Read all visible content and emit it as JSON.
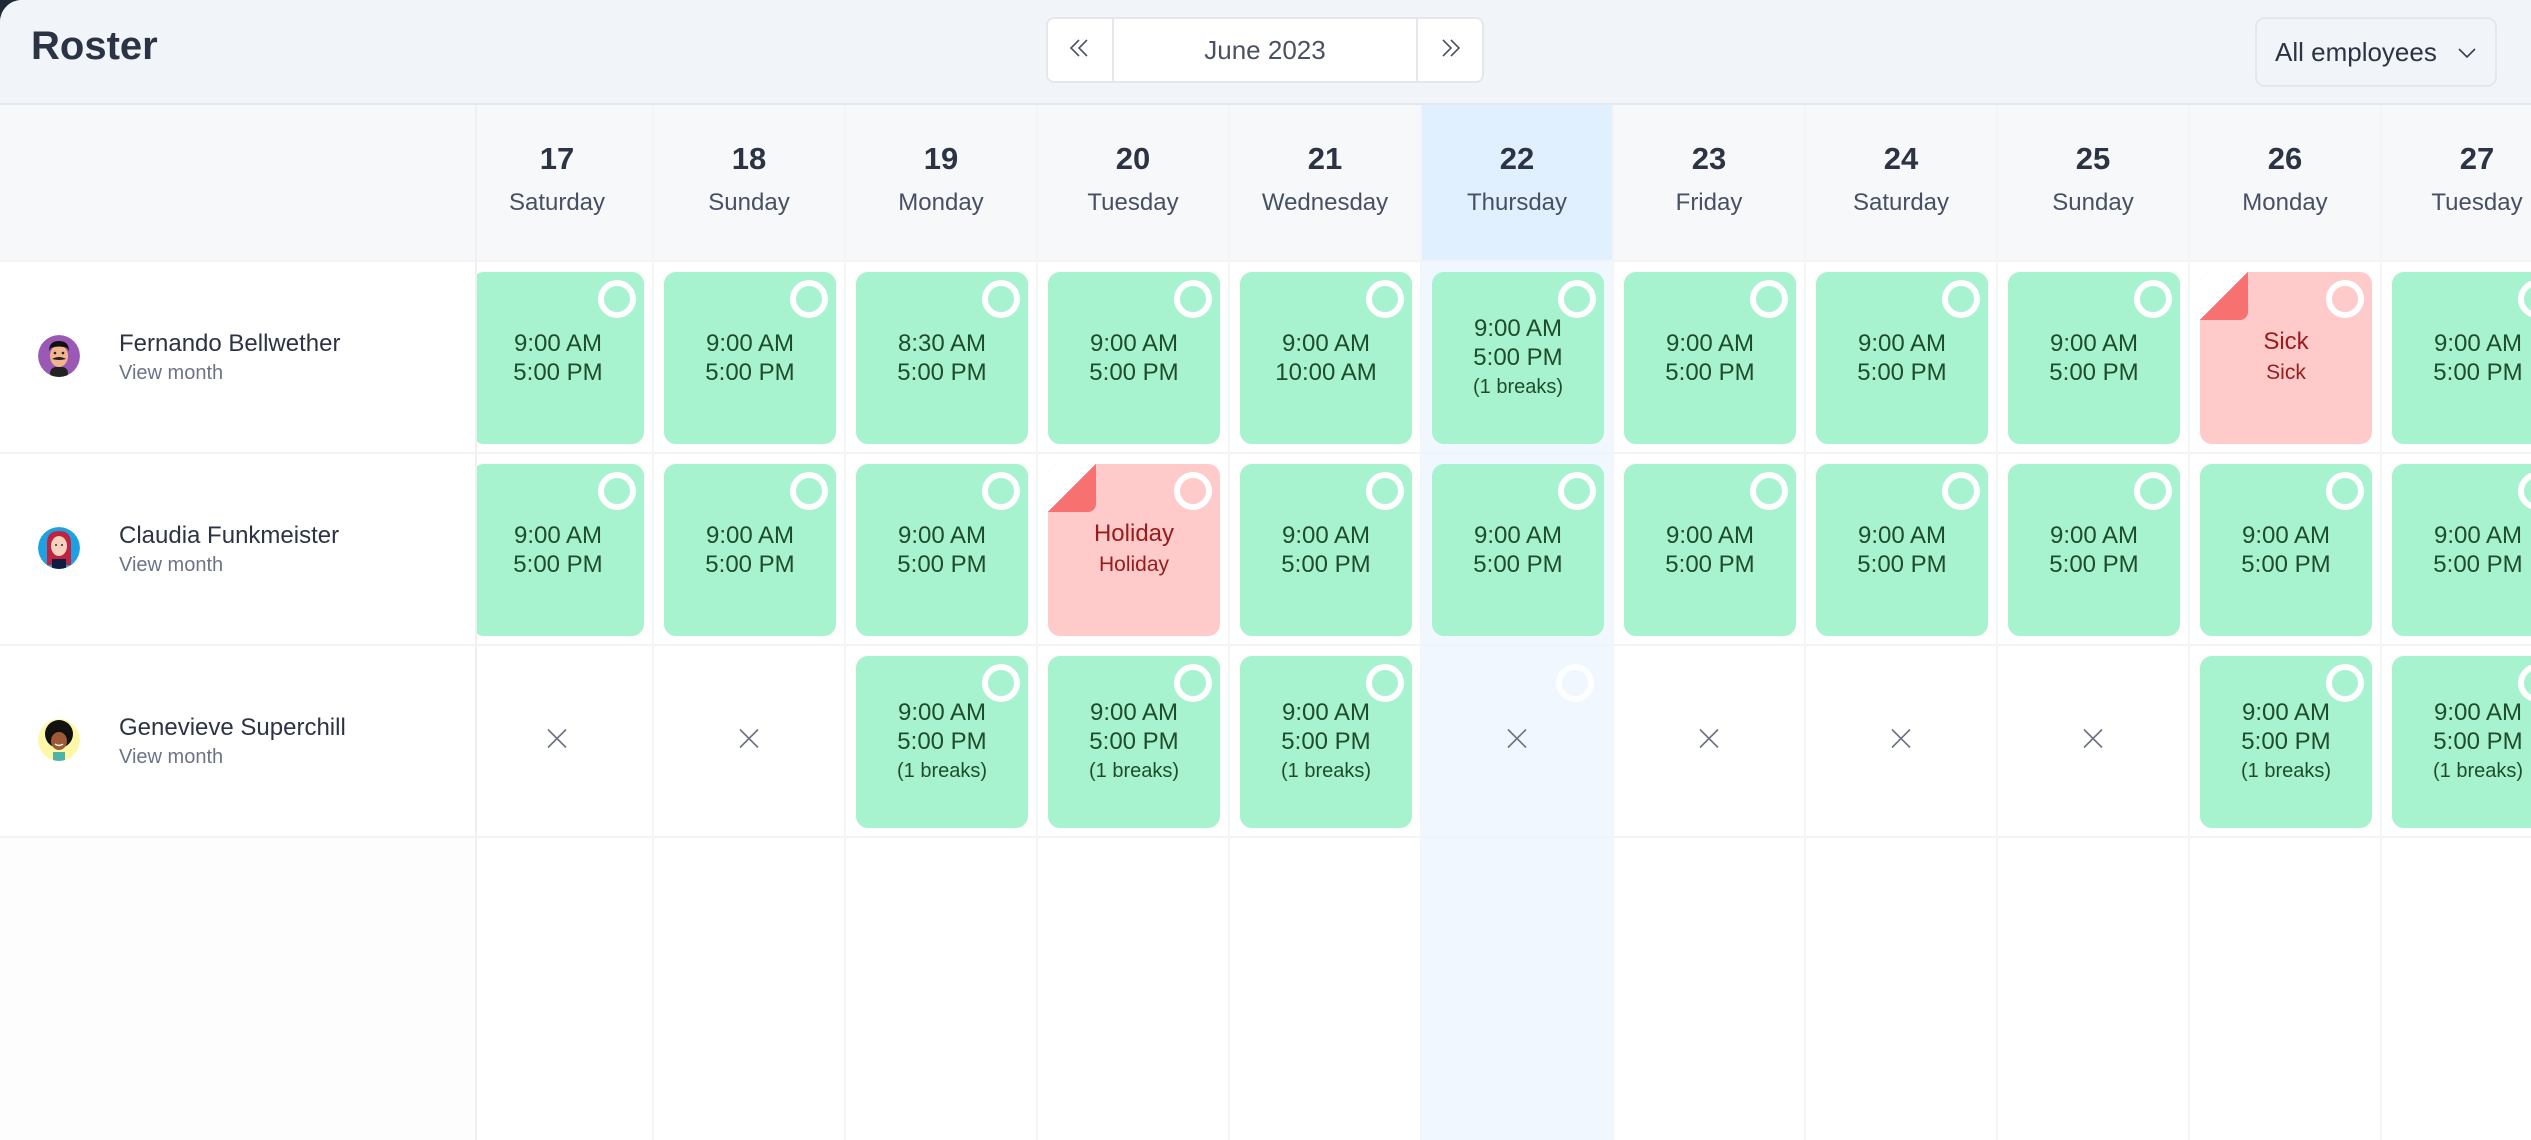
{
  "header": {
    "title": "Roster",
    "month_label": "June 2023",
    "prev_icon": "double-chevron-left-icon",
    "next_icon": "double-chevron-right-icon",
    "filter_value": "All employees"
  },
  "days": [
    {
      "num": "17",
      "name": "Saturday",
      "today": false
    },
    {
      "num": "18",
      "name": "Sunday",
      "today": false
    },
    {
      "num": "19",
      "name": "Monday",
      "today": false
    },
    {
      "num": "20",
      "name": "Tuesday",
      "today": false
    },
    {
      "num": "21",
      "name": "Wednesday",
      "today": false
    },
    {
      "num": "22",
      "name": "Thursday",
      "today": true
    },
    {
      "num": "23",
      "name": "Friday",
      "today": false
    },
    {
      "num": "24",
      "name": "Saturday",
      "today": false
    },
    {
      "num": "25",
      "name": "Sunday",
      "today": false
    },
    {
      "num": "26",
      "name": "Monday",
      "today": false
    },
    {
      "num": "27",
      "name": "Tuesday",
      "today": false
    }
  ],
  "employees": [
    {
      "name": "Fernando Bellwether",
      "link": "View month",
      "avatar": "avatar-mustache-man",
      "shifts": [
        {
          "type": "shift",
          "start": "9:00 AM",
          "end": "5:00 PM"
        },
        {
          "type": "shift",
          "start": "9:00 AM",
          "end": "5:00 PM"
        },
        {
          "type": "shift",
          "start": "8:30 AM",
          "end": "5:00 PM"
        },
        {
          "type": "shift",
          "start": "9:00 AM",
          "end": "5:00 PM"
        },
        {
          "type": "shift",
          "start": "9:00 AM",
          "end": "10:00 AM"
        },
        {
          "type": "shift",
          "start": "9:00 AM",
          "end": "5:00 PM",
          "breaks": "(1 breaks)"
        },
        {
          "type": "shift",
          "start": "9:00 AM",
          "end": "5:00 PM"
        },
        {
          "type": "shift",
          "start": "9:00 AM",
          "end": "5:00 PM"
        },
        {
          "type": "shift",
          "start": "9:00 AM",
          "end": "5:00 PM"
        },
        {
          "type": "absence",
          "title": "Sick",
          "sub": "Sick"
        },
        {
          "type": "shift",
          "start": "9:00 AM",
          "end": "5:00 PM"
        }
      ]
    },
    {
      "name": "Claudia Funkmeister",
      "link": "View month",
      "avatar": "avatar-red-hair-woman",
      "shifts": [
        {
          "type": "shift",
          "start": "9:00 AM",
          "end": "5:00 PM"
        },
        {
          "type": "shift",
          "start": "9:00 AM",
          "end": "5:00 PM"
        },
        {
          "type": "shift",
          "start": "9:00 AM",
          "end": "5:00 PM"
        },
        {
          "type": "absence",
          "title": "Holiday",
          "sub": "Holiday"
        },
        {
          "type": "shift",
          "start": "9:00 AM",
          "end": "5:00 PM"
        },
        {
          "type": "shift",
          "start": "9:00 AM",
          "end": "5:00 PM"
        },
        {
          "type": "shift",
          "start": "9:00 AM",
          "end": "5:00 PM"
        },
        {
          "type": "shift",
          "start": "9:00 AM",
          "end": "5:00 PM"
        },
        {
          "type": "shift",
          "start": "9:00 AM",
          "end": "5:00 PM"
        },
        {
          "type": "shift",
          "start": "9:00 AM",
          "end": "5:00 PM"
        },
        {
          "type": "shift",
          "start": "9:00 AM",
          "end": "5:00 PM"
        }
      ]
    },
    {
      "name": "Genevieve Superchill",
      "link": "View month",
      "avatar": "avatar-afro-woman",
      "shifts": [
        {
          "type": "off"
        },
        {
          "type": "off"
        },
        {
          "type": "shift",
          "start": "9:00 AM",
          "end": "5:00 PM",
          "breaks": "(1 breaks)"
        },
        {
          "type": "shift",
          "start": "9:00 AM",
          "end": "5:00 PM",
          "breaks": "(1 breaks)"
        },
        {
          "type": "shift",
          "start": "9:00 AM",
          "end": "5:00 PM",
          "breaks": "(1 breaks)"
        },
        {
          "type": "off",
          "ring": true
        },
        {
          "type": "off"
        },
        {
          "type": "off"
        },
        {
          "type": "off"
        },
        {
          "type": "shift",
          "start": "9:00 AM",
          "end": "5:00 PM",
          "breaks": "(1 breaks)"
        },
        {
          "type": "shift",
          "start": "9:00 AM",
          "end": "5:00 PM",
          "breaks": "(1 breaks)"
        }
      ]
    }
  ],
  "colors": {
    "shift": "#a7f3d0",
    "absence": "#fecaca",
    "absence_fold": "#f87171",
    "today_header": "#e0f0fe",
    "today_column": "#f0f7fe"
  }
}
